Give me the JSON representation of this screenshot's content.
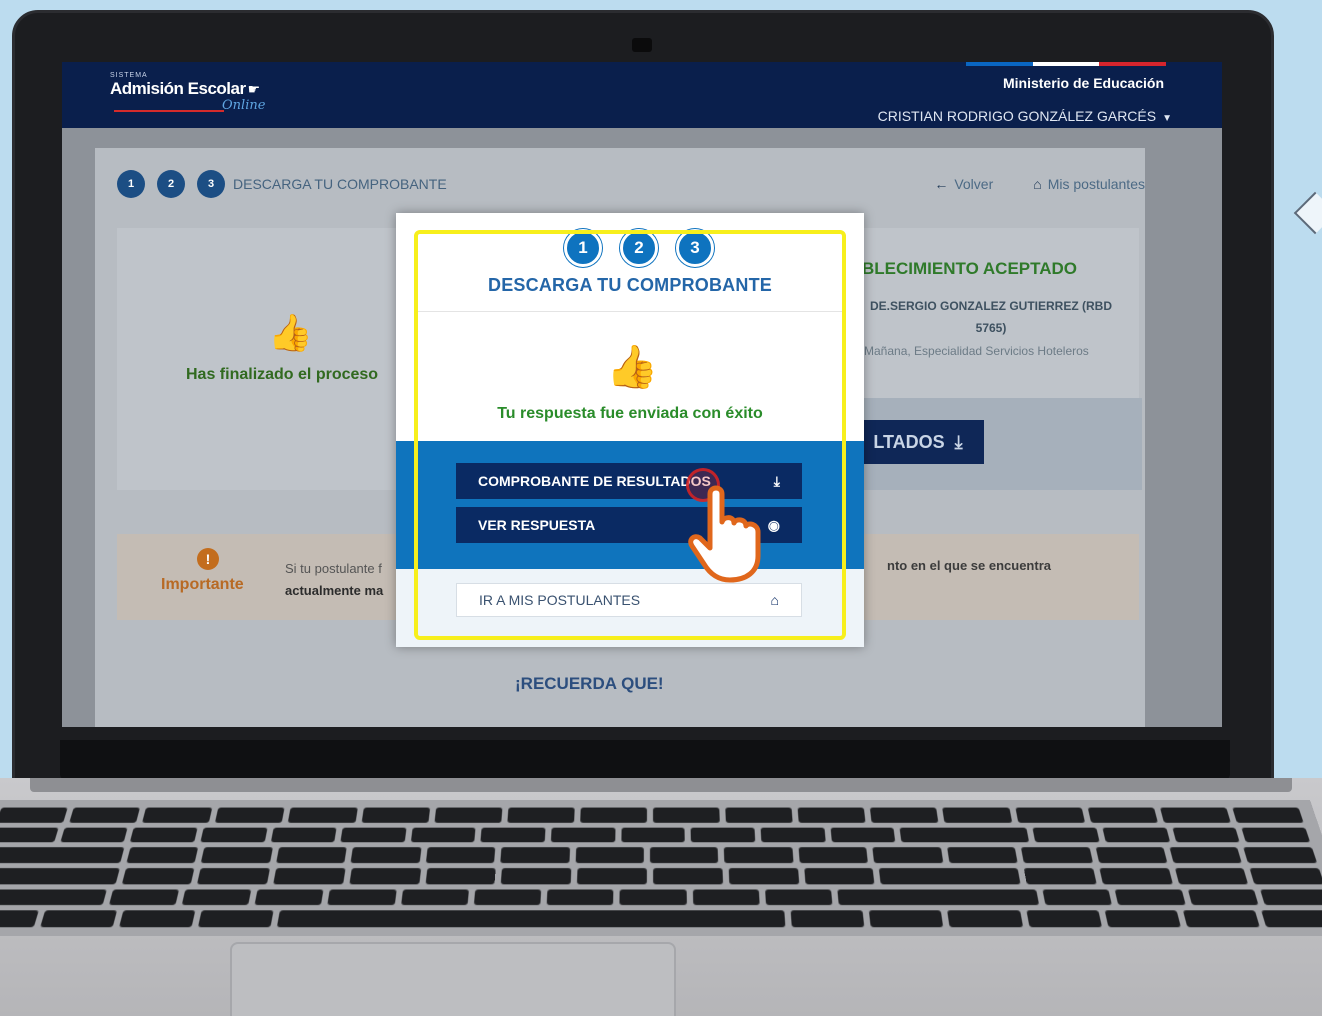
{
  "app": {
    "brand_small": "SISTEMA",
    "brand_name": "Admisión Escolar",
    "brand_script": "Online",
    "ministry": "Ministerio de Educación",
    "user": "CRISTIAN RODRIGO GONZÁLEZ GARCÉS",
    "flag_colors": [
      "#0a66c2",
      "#ffffff",
      "#d6252d"
    ]
  },
  "page": {
    "steps": [
      "1",
      "2",
      "3"
    ],
    "step_title": "DESCARGA TU COMPROBANTE",
    "back_label": "Volver",
    "applicants_label": "Mis postulantes",
    "finished_text": "Has finalizado el proceso",
    "accepted_title": "ESTABLECIMIENTO ACEPTADO",
    "accepted_title_visible": "BLECIMIENTO ACEPTADO",
    "school_visible": "DE.SERGIO GONZALEZ GUTIERREZ (RBD 5765)",
    "school_detail_visible": "Mañana, Especialidad Servicios Hoteleros",
    "results_btn_visible": "LTADOS",
    "important_label": "Importante",
    "important_text_visible": "Si tu postulante f",
    "important_bold_visible": "actualmente ma",
    "important_right_visible": "nto en el que se encuentra",
    "remember": "¡RECUERDA QUE!"
  },
  "modal": {
    "steps": [
      "1",
      "2",
      "3"
    ],
    "title": "DESCARGA TU COMPROBANTE",
    "success": "Tu respuesta fue enviada con éxito",
    "download_btn": "COMPROBANTE DE RESULTADOS",
    "view_btn": "VER RESPUESTA",
    "applicants_link": "IR A MIS POSTULANTES",
    "icons": {
      "download": "download-icon",
      "view": "eye-icon",
      "home": "home-icon",
      "success": "thumbs-up-icon"
    },
    "accent_color": "#0f74bd",
    "button_color": "#0a2a63",
    "success_color": "#2a8c2a",
    "highlight_color": "#f7ef1c"
  }
}
